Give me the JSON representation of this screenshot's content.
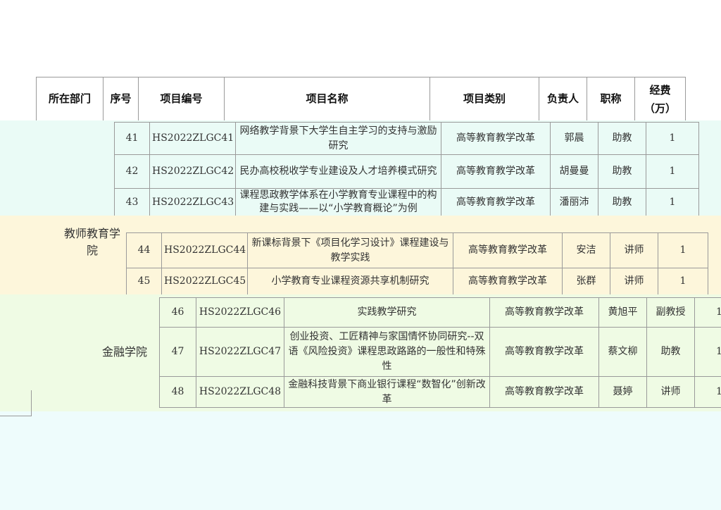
{
  "headers": [
    "所在部门",
    "序号",
    "项目编号",
    "项目名称",
    "项目类别",
    "负责人",
    "职称",
    "经费\n（万）"
  ],
  "rows": [
    {
      "seq": "41",
      "code": "HS2022ZLGC41",
      "name": "网络教学背景下大学生自主学习的支持与激励研究",
      "category": "高等教育教学改革",
      "leader": "郭晨",
      "title": "助教",
      "fund": "1"
    },
    {
      "seq": "42",
      "code": "HS2022ZLGC42",
      "name": "民办高校税收学专业建设及人才培养模式研究",
      "category": "高等教育教学改革",
      "leader": "胡曼曼",
      "title": "助教",
      "fund": "1"
    },
    {
      "seq": "43",
      "code": "HS2022ZLGC43",
      "name": "课程思政教学体系在小学教育专业课程中的构建与实践——以“小学教育概论”为例",
      "category": "高等教育教学改革",
      "leader": "潘丽沛",
      "title": "助教",
      "fund": "1"
    },
    {
      "seq": "44",
      "code": "HS2022ZLGC44",
      "name": "新课标背景下《项目化学习设计》课程建设与教学实践",
      "category": "高等教育教学改革",
      "leader": "安洁",
      "title": "讲师",
      "fund": "1"
    },
    {
      "seq": "45",
      "code": "HS2022ZLGC45",
      "name": "小学教育专业课程资源共享机制研究",
      "category": "高等教育教学改革",
      "leader": "张群",
      "title": "讲师",
      "fund": "1"
    },
    {
      "seq": "46",
      "code": "HS2022ZLGC46",
      "name": "实践教学研究",
      "category": "高等教育教学改革",
      "leader": "黄旭平",
      "title": "副教授",
      "fund": "1"
    },
    {
      "seq": "47",
      "code": "HS2022ZLGC47",
      "name": "创业投资、工匠精神与家国情怀协同研究--双语《风险投资》课程思政路路的一般性和特殊性",
      "category": "高等教育教学改革",
      "leader": "蔡文柳",
      "title": "助教",
      "fund": "1"
    },
    {
      "seq": "48",
      "code": "HS2022ZLGC48",
      "name": "金融科技背景下商业银行课程“数智化”创新改革",
      "category": "高等教育教学改革",
      "leader": "聂婷",
      "title": "讲师",
      "fund": "1"
    }
  ],
  "departments": [
    "教师教育学院",
    "金融学院"
  ]
}
